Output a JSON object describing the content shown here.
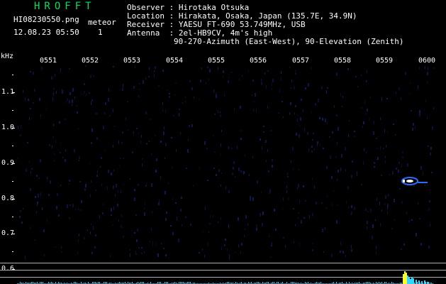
{
  "header": {
    "brand": "HROFFT",
    "filename": "HI08230550.png",
    "timestamp": "12.08.23 05:50",
    "meteor_label": "meteor",
    "meteor_count": "1",
    "observer_line": "Observer : Hirotaka Otsuka",
    "location_line": "Location : Hirakata, Osaka, Japan (135.7E, 34.9N)",
    "receiver_line": "Receiver : YAESU FT-690 53.749MHz, USB",
    "antenna_line": "Antenna  : 2el-HB9CV, 4m's high",
    "antenna_line2": "90-270-Azimuth (East-West), 90-Elevation (Zenith)"
  },
  "axes": {
    "y_unit": "kHz",
    "time_ticks": [
      "0551",
      "0552",
      "0553",
      "0554",
      "0555",
      "0556",
      "0557",
      "0558",
      "0559",
      "0600"
    ],
    "freq_ticks": [
      "1.1",
      "1.0",
      "0.9",
      "0.8",
      "0.7",
      "0.6"
    ]
  },
  "colors": {
    "background": "#000000",
    "brand": "#00e060",
    "text": "#ffffff",
    "reference_line": "#b0b0b0",
    "noise": "#101c5a",
    "echo": "#2a6cff",
    "echo_core": "#ffffff",
    "baseline_level": "#30d8ff",
    "baseline_peak": "#ffff30"
  }
}
